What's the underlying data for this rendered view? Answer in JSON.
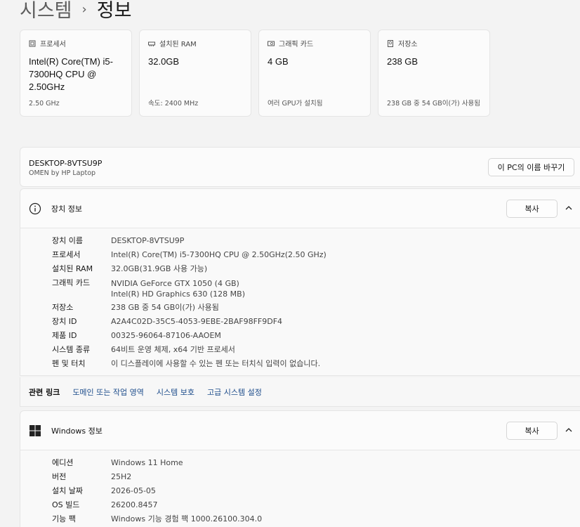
{
  "breadcrumb": {
    "parent": "시스템",
    "current": "정보"
  },
  "cards": [
    {
      "icon": "processor-icon",
      "title": "프로세서",
      "value": "Intel(R) Core(TM) i5-7300HQ CPU @ 2.50GHz",
      "sub": "2.50 GHz"
    },
    {
      "icon": "ram-icon",
      "title": "설치된 RAM",
      "value": "32.0GB",
      "sub": "속도: 2400 MHz"
    },
    {
      "icon": "gpu-icon",
      "title": "그래픽 카드",
      "value": "4 GB",
      "sub": "여러 GPU가 설치됨"
    },
    {
      "icon": "storage-icon",
      "title": "저장소",
      "value": "238 GB",
      "sub": "238 GB 중 54 GB이(가) 사용됨"
    }
  ],
  "device": {
    "name": "DESKTOP-8VTSU9P",
    "model": "OMEN by HP Laptop",
    "rename_label": "이 PC의 이름 바꾸기"
  },
  "device_specs": {
    "title": "장치 정보",
    "copy_label": "복사",
    "rows": [
      {
        "label": "장치 이름",
        "value": "DESKTOP-8VTSU9P"
      },
      {
        "label": "프로세서",
        "value": "Intel(R) Core(TM) i5-7300HQ CPU @ 2.50GHz(2.50 GHz)"
      },
      {
        "label": "설치된 RAM",
        "value": "32.0GB(31.9GB 사용 가능)"
      },
      {
        "label": "그래픽 카드",
        "value": "NVIDIA GeForce GTX 1050 (4 GB)",
        "value2": "Intel(R) HD Graphics 630 (128 MB)"
      },
      {
        "label": "저장소",
        "value": "238 GB 중 54 GB이(가) 사용됨"
      },
      {
        "label": "장치 ID",
        "value": "A2A4C02D-35C5-4053-9EBE-2BAF98FF9DF4"
      },
      {
        "label": "제품 ID",
        "value": "00325-96064-87106-AAOEM"
      },
      {
        "label": "시스템 종류",
        "value": "64비트 운영 체제, x64 기반 프로세서"
      },
      {
        "label": "펜 및 터치",
        "value": "이 디스플레이에 사용할 수 있는 펜 또는 터치식 입력이 없습니다."
      }
    ]
  },
  "related": {
    "label": "관련 링크",
    "links": [
      "도메인 또는 작업 영역",
      "시스템 보호",
      "고급 시스템 설정"
    ]
  },
  "windows_specs": {
    "title": "Windows 정보",
    "copy_label": "복사",
    "rows": [
      {
        "label": "에디션",
        "value": "Windows 11 Home"
      },
      {
        "label": "버전",
        "value": "25H2"
      },
      {
        "label": "설치 날짜",
        "value": "2026-05-05"
      },
      {
        "label": "OS 빌드",
        "value": "26200.8457"
      },
      {
        "label": "기능 팩",
        "value": "Windows 기능 경험 팩 1000.26100.304.0"
      }
    ]
  },
  "colors": {
    "link": "#1f4e8c",
    "card_bg": "#fbfbfb",
    "page_bg": "#f3f3f3"
  }
}
